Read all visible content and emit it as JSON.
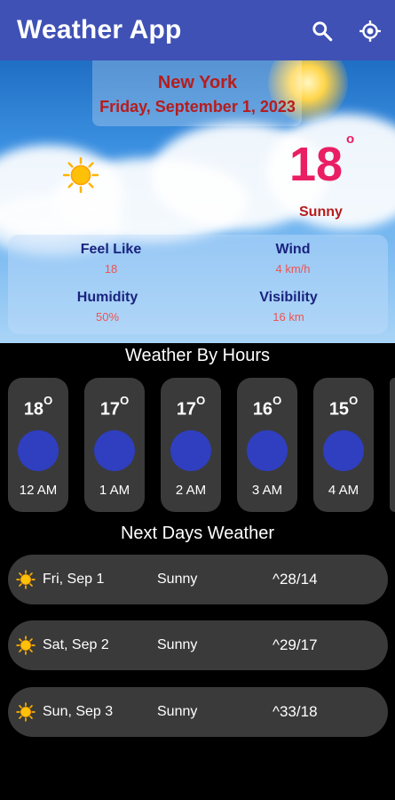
{
  "appbar": {
    "title": "Weather App",
    "search_icon": "search-icon",
    "location_icon": "my-location-icon"
  },
  "current": {
    "city": "New York",
    "date": "Friday, September 1, 2023",
    "temperature": "18",
    "degree_symbol": "o",
    "condition": "Sunny",
    "icon": "sun-icon"
  },
  "stats": {
    "feel_like": {
      "label": "Feel Like",
      "value": "18"
    },
    "wind": {
      "label": "Wind",
      "value": "4 km/h"
    },
    "humidity": {
      "label": "Humidity",
      "value": "50%"
    },
    "visibility": {
      "label": "Visibility",
      "value": "16 km"
    }
  },
  "hourly": {
    "title": "Weather By Hours",
    "items": [
      {
        "temp": "18",
        "deg": "O",
        "time": "12 AM",
        "icon": "moon-icon"
      },
      {
        "temp": "17",
        "deg": "O",
        "time": "1 AM",
        "icon": "moon-icon"
      },
      {
        "temp": "17",
        "deg": "O",
        "time": "2 AM",
        "icon": "moon-icon"
      },
      {
        "temp": "16",
        "deg": "O",
        "time": "3 AM",
        "icon": "moon-icon"
      },
      {
        "temp": "15",
        "deg": "O",
        "time": "4 AM",
        "icon": "moon-icon"
      }
    ]
  },
  "daily": {
    "title": "Next Days Weather",
    "items": [
      {
        "date": "Fri, Sep 1",
        "condition": "Sunny",
        "temps": "^28/14",
        "icon": "sun-icon"
      },
      {
        "date": "Sat, Sep 2",
        "condition": "Sunny",
        "temps": "^29/17",
        "icon": "sun-icon"
      },
      {
        "date": "Sun, Sep 3",
        "condition": "Sunny",
        "temps": "^33/18",
        "icon": "sun-icon"
      }
    ]
  },
  "colors": {
    "appbar": "#3f51b5",
    "city_text": "#b71c1c",
    "temperature": "#e91e63",
    "stat_label": "#1a237e",
    "stat_value": "#ef5350",
    "card_bg": "#3a3a3a",
    "moon_circle": "#2f3fbf"
  }
}
